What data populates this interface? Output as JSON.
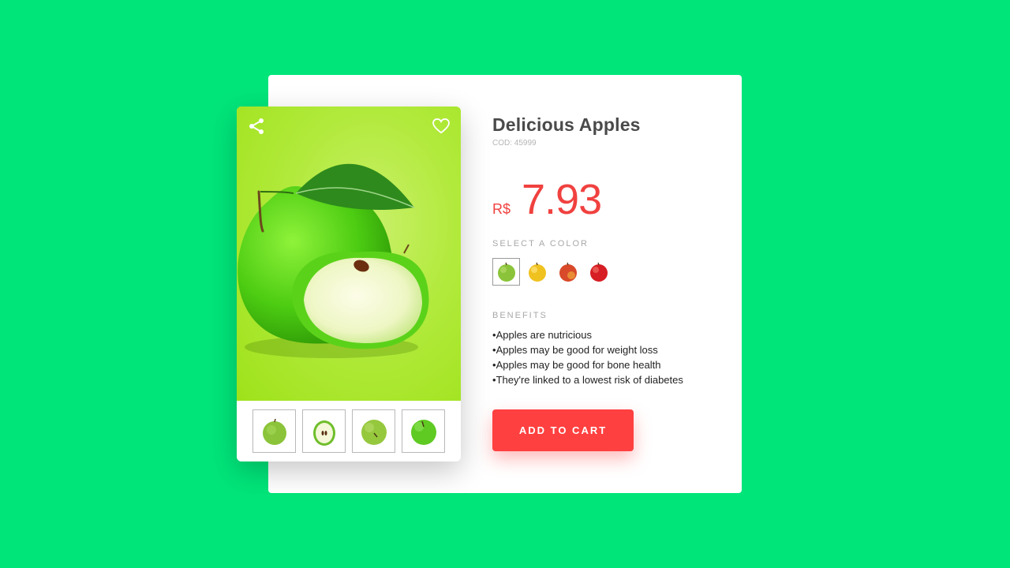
{
  "product": {
    "title": "Delicious Apples",
    "code": "COD: 45999",
    "currency": "R$",
    "price": "7.93"
  },
  "colors": {
    "label": "SELECT A COLOR",
    "options": [
      "green-apple-icon",
      "yellow-apple-icon",
      "red-yellow-apple-icon",
      "red-apple-icon"
    ],
    "selected_index": 0
  },
  "benefits": {
    "label": "BENEFITS",
    "items": [
      "Apples are nutricious",
      "Apples may be good for weight loss",
      "Apples may be good for bone health",
      "They're linked to a lowest risk of diabetes"
    ]
  },
  "actions": {
    "add_to_cart": "ADD TO CART"
  },
  "icons": {
    "share": "share-icon",
    "favorite": "heart-icon"
  },
  "thumbnails": [
    "whole-green-apple",
    "halved-green-apple",
    "green-apple-top",
    "green-apple-stem"
  ],
  "theme": {
    "background": "#00e57a",
    "accent": "#f0413f",
    "button": "#ff4040"
  }
}
